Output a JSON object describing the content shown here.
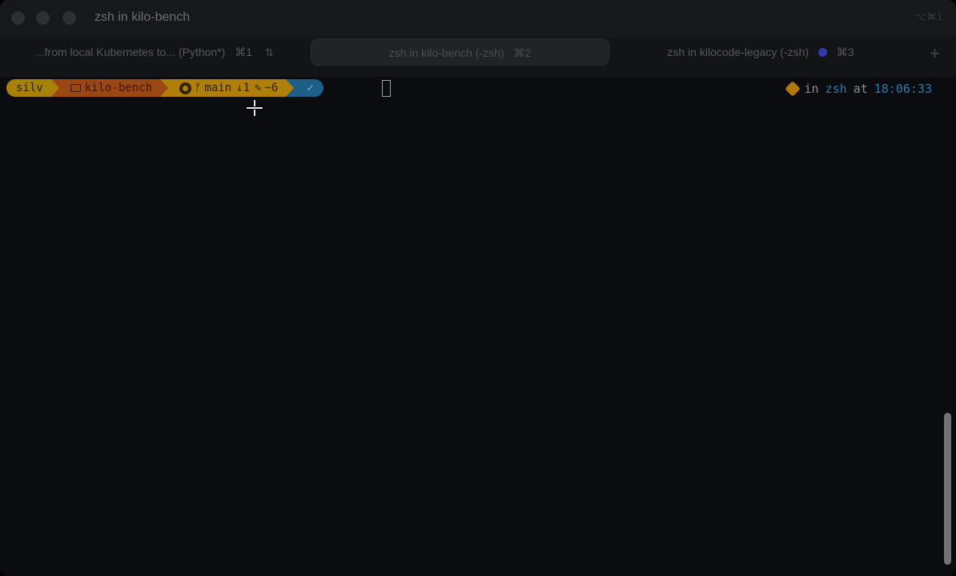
{
  "window": {
    "title": "zsh in kilo-bench",
    "title_shortcut": "⌥⌘1"
  },
  "tabs": [
    {
      "label": "...from local Kubernetes to... (Python*)",
      "shortcut": "⌘1",
      "active": false
    },
    {
      "label": "zsh in kilo-bench (-zsh)",
      "shortcut": "⌘2",
      "active": true
    },
    {
      "label": "zsh in kilocode-legacy (-zsh)",
      "shortcut": "⌘3",
      "active": false,
      "has_activity_dot": true
    }
  ],
  "new_tab_label": "+",
  "prompt": {
    "user": "silv",
    "directory": "kilo-bench",
    "branch": "main",
    "behind": "↓1",
    "modified": "~6",
    "status_symbol": "✓"
  },
  "right_prompt": {
    "in_word": "in",
    "shell": "zsh",
    "at_word": "at",
    "time": "18:06:33"
  },
  "colors": {
    "user_segment": "#a88109",
    "dir_segment": "#9b4714",
    "git_segment": "#b07e0a",
    "status_segment": "#1f5e86",
    "time": "#2a7ab0"
  }
}
